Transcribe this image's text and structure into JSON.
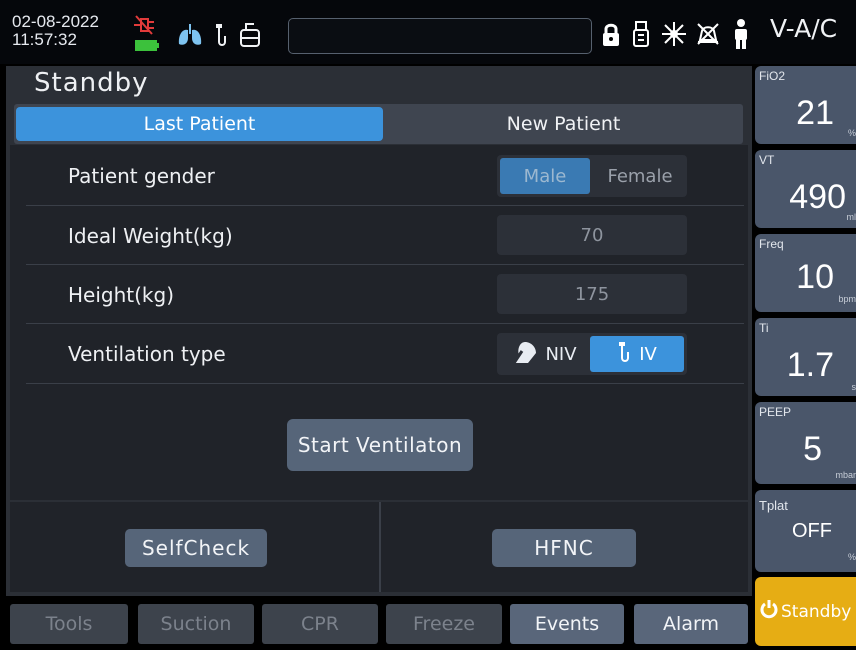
{
  "status_bar": {
    "date": "02-08-2022",
    "time": "11:57:32",
    "status_icons": [
      "ac-power-disconnected-icon",
      "battery-icon",
      "lungs-icon",
      "tube-icon",
      "humidifier-icon"
    ],
    "message": "",
    "right_icons": [
      "lock-icon",
      "usb-icon",
      "network-icon",
      "alarm-silenced-icon",
      "patient-icon"
    ],
    "mode": "V-A/C"
  },
  "main": {
    "title": "Standby",
    "tabs": [
      {
        "label": "Last Patient",
        "active": true
      },
      {
        "label": "New Patient",
        "active": false
      }
    ],
    "form": {
      "gender": {
        "label": "Patient gender",
        "options": [
          "Male",
          "Female"
        ],
        "selected": "Male"
      },
      "weight": {
        "label": "Ideal Weight(kg)",
        "value": "70"
      },
      "height": {
        "label": "Height(kg)",
        "value": "175"
      },
      "ventilation": {
        "label": "Ventilation type",
        "options": [
          "NIV",
          "IV"
        ],
        "selected": "IV"
      }
    },
    "start_button": "Start Ventilaton",
    "selfcheck_button": "SelfCheck",
    "hfnc_button": "HFNC"
  },
  "nav": [
    {
      "label": "Tools",
      "enabled": false
    },
    {
      "label": "Suction",
      "enabled": false
    },
    {
      "label": "CPR",
      "enabled": false
    },
    {
      "label": "Freeze",
      "enabled": false
    },
    {
      "label": "Events",
      "enabled": true
    },
    {
      "label": "Alarm",
      "enabled": true
    }
  ],
  "params": [
    {
      "name": "FiO2",
      "value": "21",
      "unit": "%"
    },
    {
      "name": "VT",
      "value": "490",
      "unit": "ml"
    },
    {
      "name": "Freq",
      "value": "10",
      "unit": "bpm"
    },
    {
      "name": "Ti",
      "value": "1.7",
      "unit": "s"
    },
    {
      "name": "PEEP",
      "value": "5",
      "unit": "mbar"
    },
    {
      "name": "Tplat",
      "value": "OFF",
      "unit": "%"
    }
  ],
  "standby_button": "Standby",
  "colors": {
    "accent_blue": "#3c93dc",
    "standby_yellow": "#e6ad14",
    "param_tile": "#4a566a",
    "button": "#566579"
  }
}
